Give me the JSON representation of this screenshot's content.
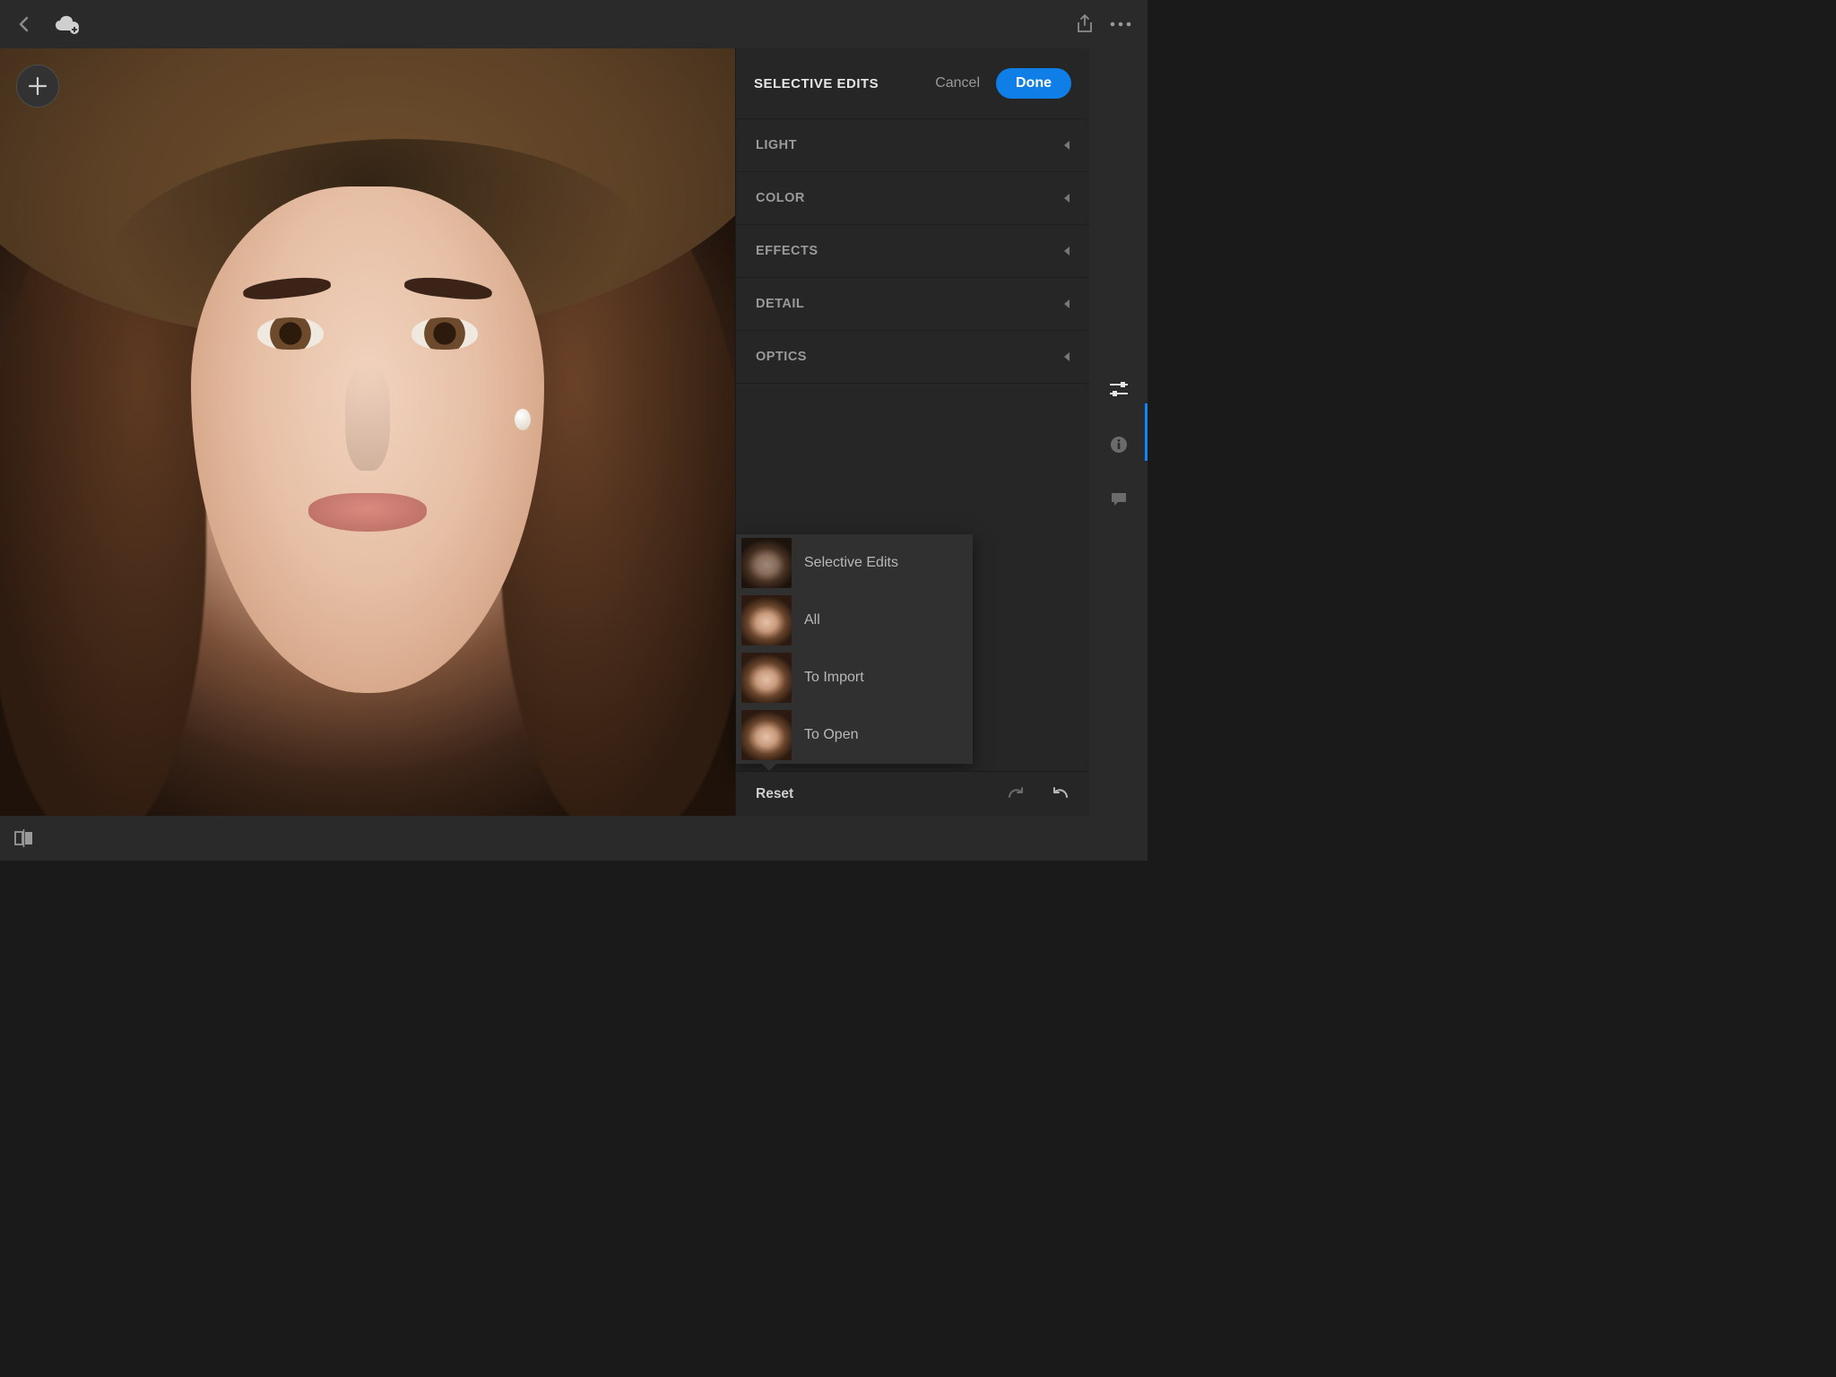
{
  "header": {
    "panel_title": "SELECTIVE EDITS",
    "cancel": "Cancel",
    "done": "Done"
  },
  "sections": [
    {
      "label": "LIGHT"
    },
    {
      "label": "COLOR"
    },
    {
      "label": "EFFECTS"
    },
    {
      "label": "DETAIL"
    },
    {
      "label": "OPTICS"
    }
  ],
  "reset_menu": {
    "items": [
      {
        "label": "Selective Edits"
      },
      {
        "label": "All"
      },
      {
        "label": "To Import"
      },
      {
        "label": "To Open"
      }
    ]
  },
  "footer": {
    "reset": "Reset"
  }
}
